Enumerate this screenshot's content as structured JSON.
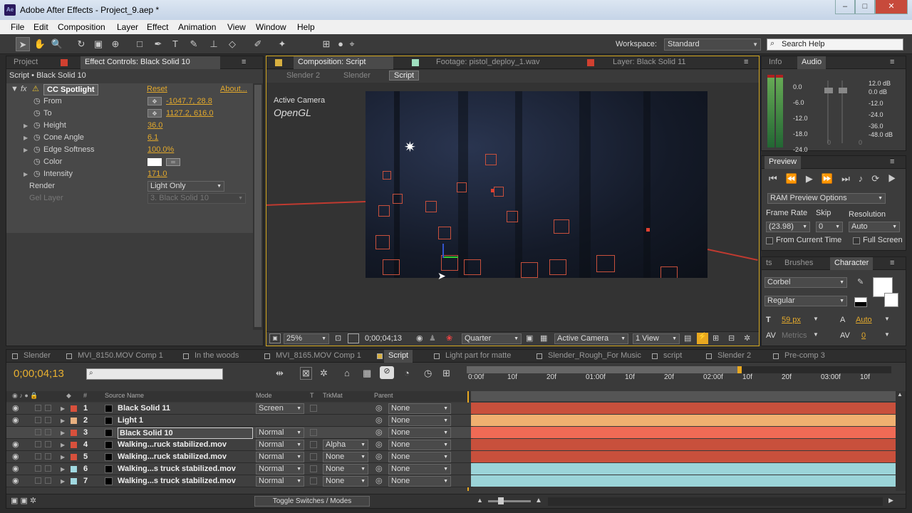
{
  "window": {
    "title": "Adobe After Effects - Project_9.aep *",
    "app_icon": "Ae"
  },
  "menu": [
    "File",
    "Edit",
    "Composition",
    "Layer",
    "Effect",
    "Animation",
    "View",
    "Window",
    "Help"
  ],
  "toolbar": {
    "workspace_label": "Workspace:",
    "workspace_value": "Standard",
    "search_placeholder": "Search Help"
  },
  "effect_controls": {
    "tab_project": "Project",
    "tab_title": "Effect Controls: Black Solid 10",
    "subtitle": "Script • Black Solid 10",
    "effect_name": "CC Spotlight",
    "reset": "Reset",
    "about": "About...",
    "rows": [
      {
        "label": "From",
        "value": "-1047.7, 28.8"
      },
      {
        "label": "To",
        "value": "1127.2, 616.0"
      },
      {
        "label": "Height",
        "value": "36.0"
      },
      {
        "label": "Cone Angle",
        "value": "6.1"
      },
      {
        "label": "Edge Softness",
        "value": "100.0%"
      },
      {
        "label": "Color",
        "value": ""
      },
      {
        "label": "Intensity",
        "value": "171.0"
      }
    ],
    "render_label": "Render",
    "render_value": "Light Only",
    "gel_label": "Gel Layer",
    "gel_value": "3. Black Solid 10"
  },
  "composition": {
    "tabs": [
      "Composition: Script",
      "Footage: pistol_deploy_1.wav",
      "Layer: Black Solid 11"
    ],
    "breadcrumbs": [
      "Slender 2",
      "Slender",
      "Script"
    ],
    "camera_label": "Active Camera",
    "renderer": "OpenGL",
    "zoom": "25%",
    "timecode": "0;00;04;13",
    "resolution": "Quarter",
    "view_camera": "Active Camera",
    "views": "1 View"
  },
  "info_panel": {
    "tab_info": "Info",
    "tab_audio": "Audio",
    "left_scale": [
      "0.0",
      "-6.0",
      "-12.0",
      "-18.0",
      "-24.0"
    ],
    "right_scale": [
      "12.0 dB",
      "0.0 dB",
      "-12.0",
      "-24.0",
      "-36.0",
      "-48.0 dB"
    ],
    "slider_labels": [
      "0",
      "0"
    ]
  },
  "preview": {
    "title": "Preview",
    "ram_options": "RAM Preview Options",
    "frame_rate_label": "Frame Rate",
    "skip_label": "Skip",
    "resolution_label": "Resolution",
    "frame_rate": "(23.98)",
    "skip": "0",
    "resolution": "Auto",
    "from_current": "From Current Time",
    "full_screen": "Full Screen"
  },
  "character": {
    "tab_partial": "ts",
    "tab_brushes": "Brushes",
    "tab_character": "Character",
    "font": "Corbel",
    "style": "Regular",
    "size": "59 px",
    "leading": "Auto",
    "kerning": "Metrics",
    "tracking": "0"
  },
  "timeline": {
    "tabs": [
      "Slender",
      "MVI_8150.MOV Comp 1",
      "In the woods",
      "MVI_8165.MOV Comp 1",
      "Script",
      "Light part for matte",
      "Slender_Rough_For Music",
      "script",
      "Slender 2",
      "Pre-comp 3"
    ],
    "timecode": "0;00;04;13",
    "columns": {
      "num": "#",
      "source": "Source Name",
      "mode": "Mode",
      "t": "T",
      "trkmat": "TrkMat",
      "parent": "Parent"
    },
    "ruler": [
      "0:00f",
      "10f",
      "20f",
      "01:00f",
      "10f",
      "20f",
      "02:00f",
      "10f",
      "20f",
      "03:00f",
      "10f"
    ],
    "layers": [
      {
        "num": "1",
        "name": "Black Solid 11",
        "mode": "Screen",
        "trkmat": "",
        "parent": "None",
        "color": "#d8503c",
        "bar": "#c8503c"
      },
      {
        "num": "2",
        "name": "Light 1",
        "mode": "",
        "trkmat": "",
        "parent": "None",
        "color": "#e8b080",
        "bar": "#f0b070"
      },
      {
        "num": "3",
        "name": "Black Solid 10",
        "mode": "Normal",
        "trkmat": "",
        "parent": "None",
        "color": "#d8503c",
        "bar": "#f06a55"
      },
      {
        "num": "4",
        "name": "Walking...ruck stabilized.mov",
        "mode": "Normal",
        "trkmat": "Alpha",
        "parent": "None",
        "color": "#d8503c",
        "bar": "#c8503c"
      },
      {
        "num": "5",
        "name": "Walking...ruck stabilized.mov",
        "mode": "Normal",
        "trkmat": "None",
        "parent": "None",
        "color": "#d8503c",
        "bar": "#c8503c"
      },
      {
        "num": "6",
        "name": "Walking...s truck stabilized.mov",
        "mode": "Normal",
        "trkmat": "None",
        "parent": "None",
        "color": "#a0d8e0",
        "bar": "#9bd4d8"
      },
      {
        "num": "7",
        "name": "Walking...s truck stabilized.mov",
        "mode": "Normal",
        "trkmat": "None",
        "parent": "None",
        "color": "#a0d8e0",
        "bar": "#9bd4d8"
      }
    ],
    "toggle_label": "Toggle Switches / Modes"
  }
}
